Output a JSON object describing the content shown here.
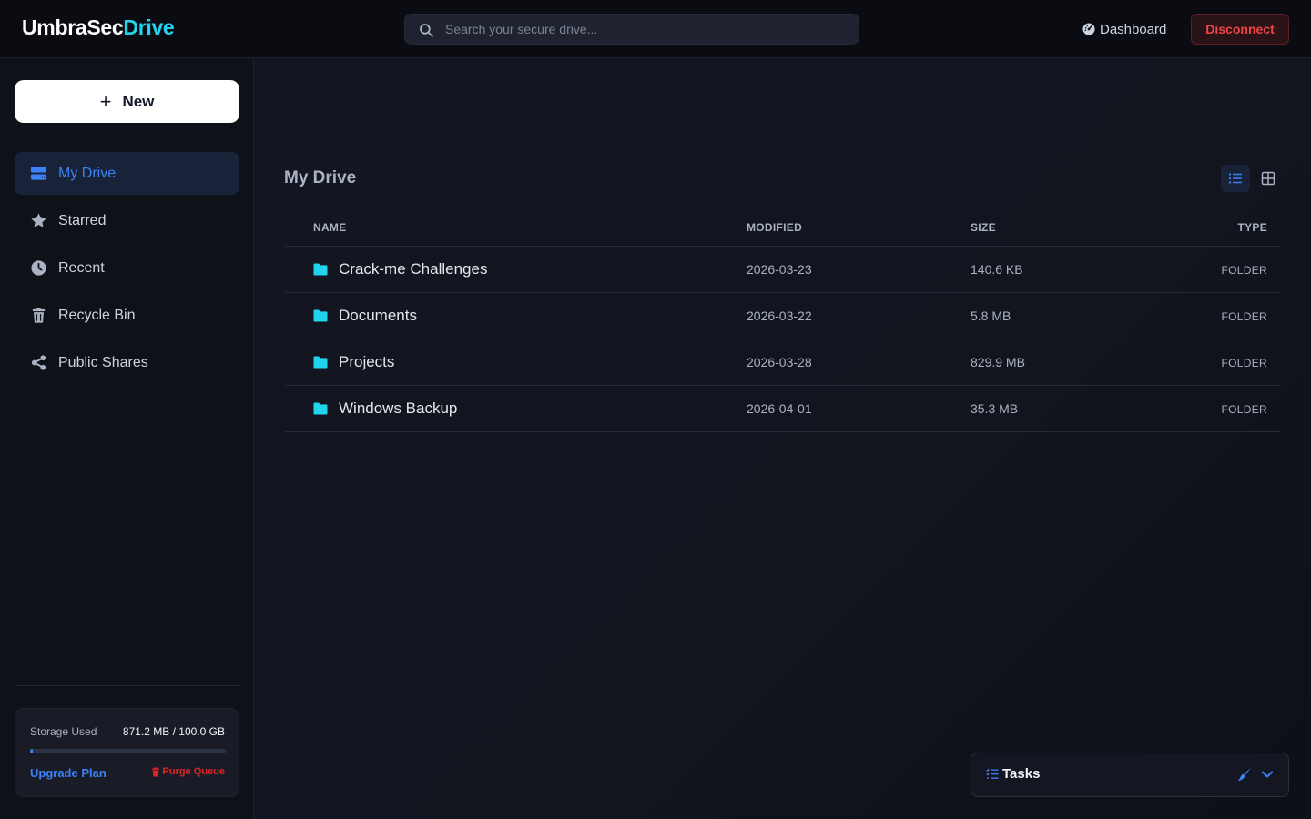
{
  "app": {
    "logo_main": "UmbraSec",
    "logo_accent": "Drive"
  },
  "header": {
    "search_placeholder": "Search your secure drive...",
    "dashboard_label": "Dashboard",
    "disconnect_label": "Disconnect"
  },
  "sidebar": {
    "new_label": "New",
    "items": [
      {
        "label": "My Drive",
        "icon": "drive-icon",
        "active": true
      },
      {
        "label": "Starred",
        "icon": "star-icon",
        "active": false
      },
      {
        "label": "Recent",
        "icon": "clock-icon",
        "active": false
      },
      {
        "label": "Recycle Bin",
        "icon": "trash-icon",
        "active": false
      },
      {
        "label": "Public Shares",
        "icon": "share-icon",
        "active": false
      }
    ],
    "storage": {
      "label": "Storage Used",
      "amount": "871.2 MB / 100.0 GB",
      "used_fraction": 0.0087,
      "upgrade_label": "Upgrade Plan",
      "purge_label": "Purge Queue"
    }
  },
  "main": {
    "title": "My Drive",
    "columns": {
      "name": "NAME",
      "modified": "MODIFIED",
      "size": "SIZE",
      "type": "TYPE"
    },
    "rows": [
      {
        "name": "Crack-me Challenges",
        "modified": "2026-03-23",
        "size": "140.6 KB",
        "type": "FOLDER"
      },
      {
        "name": "Documents",
        "modified": "2026-03-22",
        "size": "5.8 MB",
        "type": "FOLDER"
      },
      {
        "name": "Projects",
        "modified": "2026-03-28",
        "size": "829.9 MB",
        "type": "FOLDER"
      },
      {
        "name": "Windows Backup",
        "modified": "2026-04-01",
        "size": "35.3 MB",
        "type": "FOLDER"
      }
    ]
  },
  "tasks": {
    "title": "Tasks"
  },
  "colors": {
    "accent_blue": "#3b82f6",
    "logo_cyan": "#22d3ee",
    "folder_cyan": "#22d3ee",
    "danger_red": "#ef4444"
  }
}
